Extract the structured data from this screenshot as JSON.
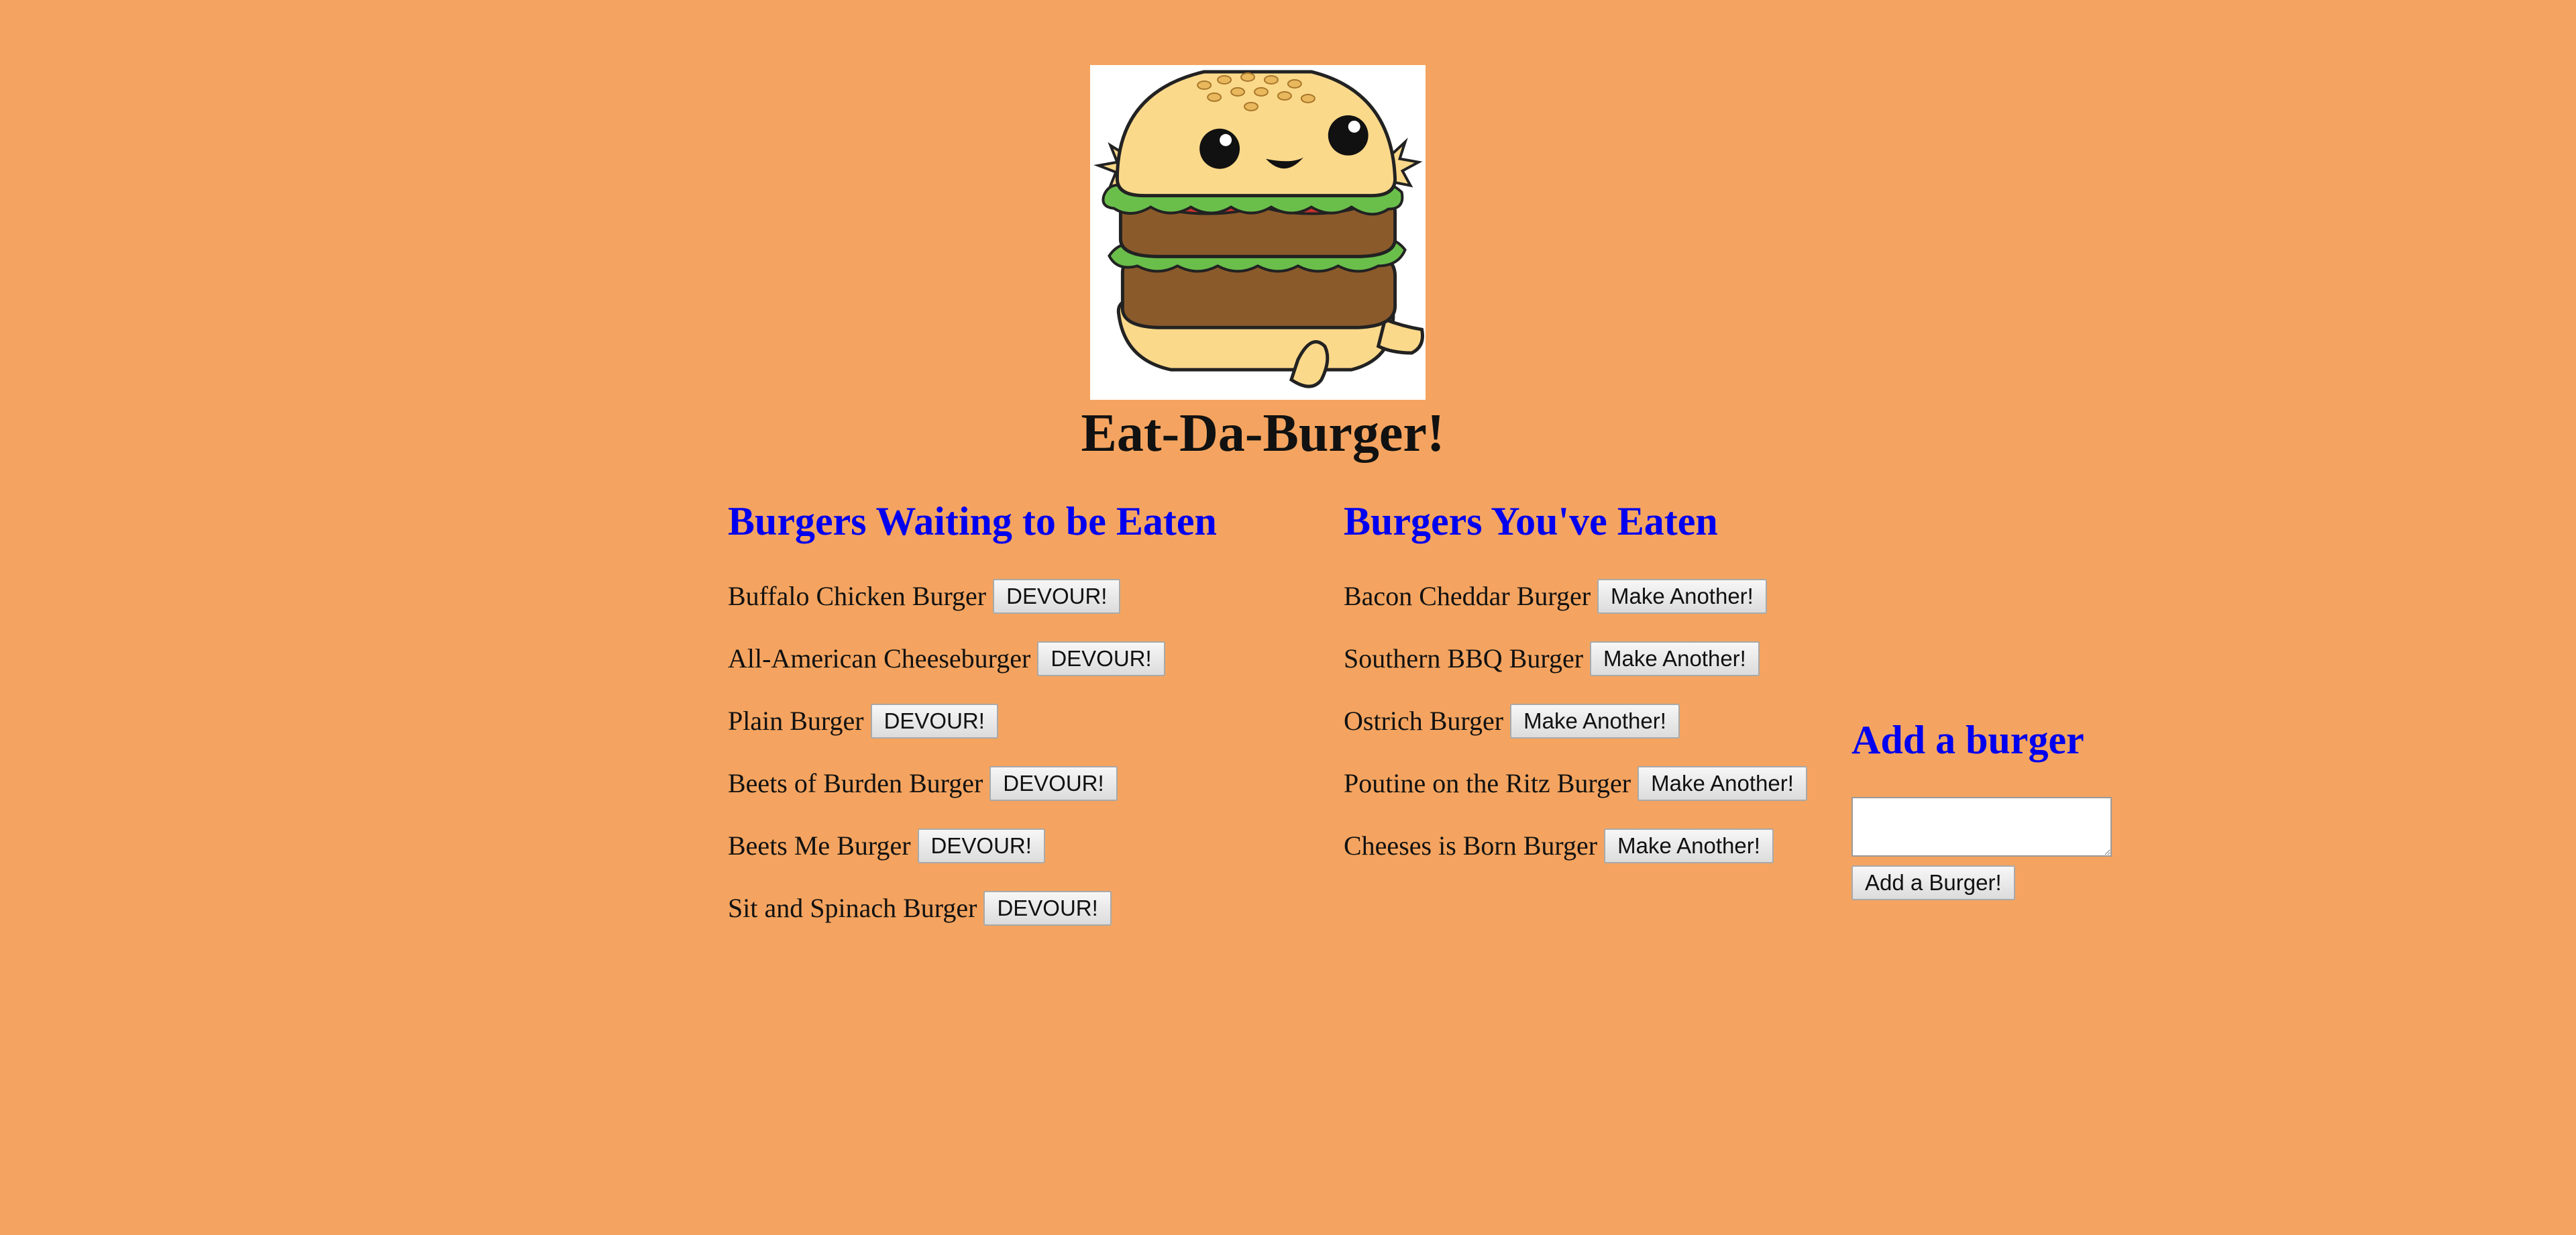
{
  "page": {
    "title": "Eat-Da-Burger!",
    "background": "#f4a460",
    "heading_color": "#0000ee",
    "logo_icon": "cartoon-burger-logo"
  },
  "waiting": {
    "heading": "Burgers Waiting to be Eaten",
    "button_label": "DEVOUR!",
    "items": [
      {
        "name": "Buffalo Chicken Burger"
      },
      {
        "name": "All-American Cheeseburger"
      },
      {
        "name": "Plain Burger"
      },
      {
        "name": "Beets of Burden Burger"
      },
      {
        "name": "Beets Me Burger"
      },
      {
        "name": "Sit and Spinach Burger"
      }
    ]
  },
  "eaten": {
    "heading": "Burgers You've Eaten",
    "button_label": "Make Another!",
    "items": [
      {
        "name": "Bacon Cheddar Burger"
      },
      {
        "name": "Southern BBQ Burger"
      },
      {
        "name": "Ostrich Burger"
      },
      {
        "name": "Poutine on the Ritz Burger"
      },
      {
        "name": "Cheeses is Born Burger"
      }
    ]
  },
  "add": {
    "heading": "Add a burger",
    "input_value": "",
    "input_placeholder": "",
    "button_label": "Add a Burger!"
  }
}
